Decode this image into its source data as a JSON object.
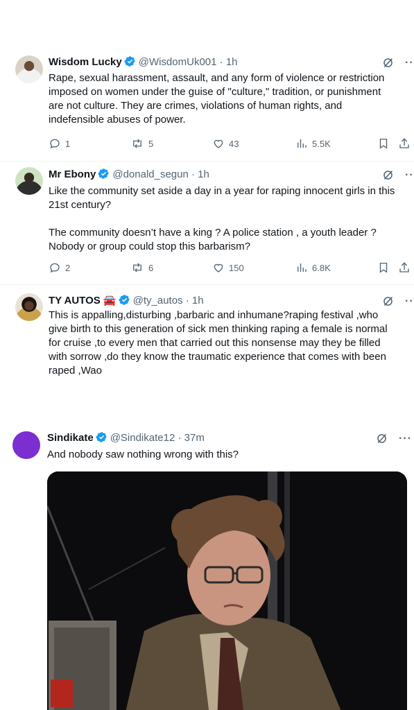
{
  "tweets": [
    {
      "name": "Wisdom Lucky",
      "handle": "@WisdomUk001",
      "time": "· 1h",
      "text": "Rape, sexual harassment, assault, and any form of violence or restriction\nimposed on women under the guise of \"culture,\" tradition, or punishment\nare not culture. They are crimes, violations of human rights, and\nindefensible abuses of power.",
      "replies": "1",
      "reposts": "5",
      "likes": "43",
      "views": "5.5K"
    },
    {
      "name": "Mr Ebony",
      "handle": "@donald_segun",
      "time": "· 1h",
      "text": "Like the community set aside a day in a year for raping innocent girls in this\n21st century?\n\nThe community doesn’t have a king ? A police station , a youth leader ?\nNobody or group could stop this barbarism?",
      "replies": "2",
      "reposts": "6",
      "likes": "150",
      "views": "6.8K"
    },
    {
      "name": "TY AUTOS",
      "handle": "@ty_autos",
      "time": "· 1h",
      "emoji": "🚘",
      "text": "This is appalling,disturbing ,barbaric and inhumane?raping festival ,who\ngive birth to this generation of sick men thinking raping a female is normal\nfor cruise ,to every men that carried out this nonsense may they be filled\nwith sorrow ,do they know the traumatic experience that comes with been\nraped ,Wao"
    },
    {
      "name": "Sindikate",
      "handle": "@Sindikate12",
      "time": "· 37m",
      "text": "And nobody saw nothing wrong with this?"
    }
  ],
  "colors": {
    "verified": "#1d9bf0",
    "muted": "#536471",
    "text": "#0f1419",
    "avatar_purple": "#7b2fd1"
  },
  "icons": [
    "verified-badge-icon",
    "grok-icon",
    "more-icon",
    "reply-icon",
    "repost-icon",
    "like-icon",
    "views-icon",
    "bookmark-icon",
    "share-icon"
  ]
}
